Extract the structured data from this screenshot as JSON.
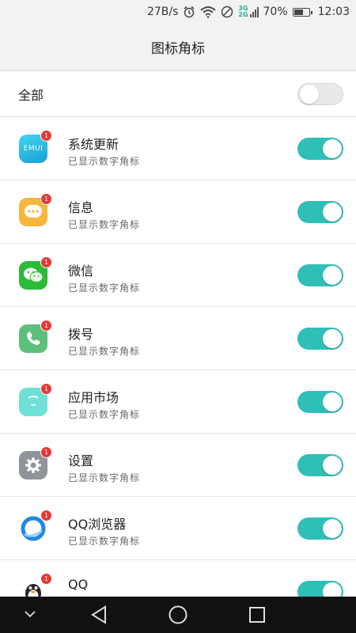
{
  "status_bar": {
    "speed": "27B/s",
    "net_top": "3G",
    "net_bottom": "2G",
    "battery_pct": "70%",
    "battery_level": 0.7,
    "time": "12:03"
  },
  "header": {
    "title": "图标角标"
  },
  "all_row": {
    "label": "全部",
    "toggle_on": false
  },
  "apps": [
    {
      "name": "系统更新",
      "status": "已显示数字角标",
      "badge": "1",
      "icon": "emui-icon",
      "icon_text": "EMUI",
      "color": "#20b8d8",
      "toggle_on": true
    },
    {
      "name": "信息",
      "status": "已显示数字角标",
      "badge": "1",
      "icon": "message-icon",
      "icon_text": "···",
      "color": "#f6b73c",
      "toggle_on": true
    },
    {
      "name": "微信",
      "status": "已显示数字角标",
      "badge": "1",
      "icon": "wechat-icon",
      "icon_text": "",
      "color": "#2dbb3a",
      "toggle_on": true
    },
    {
      "name": "拨号",
      "status": "已显示数字角标",
      "badge": "1",
      "icon": "phone-icon",
      "icon_text": "",
      "color": "#5cbf7c",
      "toggle_on": true
    },
    {
      "name": "应用市场",
      "status": "已显示数字角标",
      "badge": "1",
      "icon": "app-market-icon",
      "icon_text": "",
      "color": "#6fe0d6",
      "toggle_on": true
    },
    {
      "name": "设置",
      "status": "已显示数字角标",
      "badge": "1",
      "icon": "settings-gear-icon",
      "icon_text": "",
      "color": "#8e9499",
      "toggle_on": true
    },
    {
      "name": "QQ浏览器",
      "status": "已显示数字角标",
      "badge": "1",
      "icon": "qq-browser-icon",
      "icon_text": "",
      "color": "#1e88e5",
      "toggle_on": true
    },
    {
      "name": "QQ",
      "status": "",
      "badge": "1",
      "icon": "qq-penguin-icon",
      "icon_text": "",
      "color": "#222222",
      "toggle_on": true
    }
  ],
  "colors": {
    "accent": "#2fbfb8",
    "badge": "#e53935"
  }
}
